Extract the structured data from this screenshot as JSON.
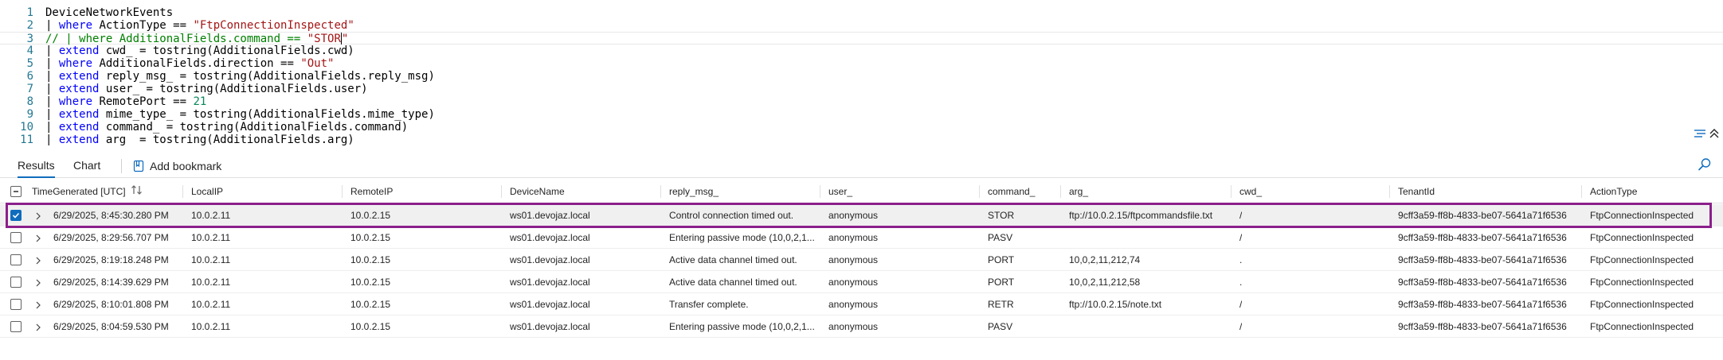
{
  "editor": {
    "lines": [
      {
        "n": "1",
        "parts": [
          {
            "c": "",
            "t": "DeviceNetworkEvents"
          }
        ]
      },
      {
        "n": "2",
        "parts": [
          {
            "c": "",
            "t": "| "
          },
          {
            "c": "kw",
            "t": "where"
          },
          {
            "c": "",
            "t": " ActionType == "
          },
          {
            "c": "str",
            "t": "\"FtpConnectionInspected\""
          }
        ]
      },
      {
        "n": "3",
        "parts": [
          {
            "c": "cmt",
            "t": "// | where AdditionalFields.command == "
          },
          {
            "c": "str",
            "t": "\"STOR"
          },
          {
            "c": "caret",
            "t": ""
          },
          {
            "c": "str",
            "t": "\""
          }
        ]
      },
      {
        "n": "4",
        "parts": [
          {
            "c": "",
            "t": "| "
          },
          {
            "c": "kw",
            "t": "extend"
          },
          {
            "c": "",
            "t": " cwd_ = tostring(AdditionalFields.cwd)"
          }
        ]
      },
      {
        "n": "5",
        "parts": [
          {
            "c": "",
            "t": "| "
          },
          {
            "c": "kw",
            "t": "where"
          },
          {
            "c": "",
            "t": " AdditionalFields.direction == "
          },
          {
            "c": "str",
            "t": "\"Out\""
          }
        ]
      },
      {
        "n": "6",
        "parts": [
          {
            "c": "",
            "t": "| "
          },
          {
            "c": "kw",
            "t": "extend"
          },
          {
            "c": "",
            "t": " reply_msg_ = tostring(AdditionalFields.reply_msg)"
          }
        ]
      },
      {
        "n": "7",
        "parts": [
          {
            "c": "",
            "t": "| "
          },
          {
            "c": "kw",
            "t": "extend"
          },
          {
            "c": "",
            "t": " user_ = tostring(AdditionalFields.user)"
          }
        ]
      },
      {
        "n": "8",
        "parts": [
          {
            "c": "",
            "t": "| "
          },
          {
            "c": "kw",
            "t": "where"
          },
          {
            "c": "",
            "t": " RemotePort == "
          },
          {
            "c": "num",
            "t": "21"
          }
        ]
      },
      {
        "n": "9",
        "parts": [
          {
            "c": "",
            "t": "| "
          },
          {
            "c": "kw",
            "t": "extend"
          },
          {
            "c": "",
            "t": " mime_type_ = tostring(AdditionalFields.mime_type)"
          }
        ]
      },
      {
        "n": "10",
        "parts": [
          {
            "c": "",
            "t": "| "
          },
          {
            "c": "kw",
            "t": "extend"
          },
          {
            "c": "",
            "t": " command_ = tostring(AdditionalFields.command)"
          }
        ]
      },
      {
        "n": "11",
        "parts": [
          {
            "c": "",
            "t": "| "
          },
          {
            "c": "kw",
            "t": "extend"
          },
          {
            "c": "",
            "t": " arg_ = tostring(AdditionalFields.arg)"
          }
        ]
      }
    ],
    "resize_handle": "...",
    "icons": [
      "format-query-icon",
      "collapse-editor-icon"
    ]
  },
  "toolbar": {
    "tab_results": "Results",
    "tab_chart": "Chart",
    "add_bookmark": "Add bookmark",
    "icons": [
      "bookmark-icon",
      "search-icon"
    ]
  },
  "grid": {
    "columns": [
      "TimeGenerated [UTC]",
      "LocalIP",
      "RemoteIP",
      "DeviceName",
      "reply_msg_",
      "user_",
      "command_",
      "arg_",
      "cwd_",
      "TenantId",
      "ActionType"
    ],
    "rows": [
      {
        "selected": true,
        "cells": [
          "6/29/2025, 8:45:30.280 PM",
          "10.0.2.11",
          "10.0.2.15",
          "ws01.devojaz.local",
          "Control connection timed out.",
          "anonymous",
          "STOR",
          "ftp://10.0.2.15/ftpcommandsfile.txt",
          "/",
          "9cff3a59-ff8b-4833-be07-5641a71f6536",
          "FtpConnectionInspected"
        ]
      },
      {
        "selected": false,
        "cells": [
          "6/29/2025, 8:29:56.707 PM",
          "10.0.2.11",
          "10.0.2.15",
          "ws01.devojaz.local",
          "Entering passive mode (10,0,2,1...",
          "anonymous",
          "PASV",
          "",
          "/",
          "9cff3a59-ff8b-4833-be07-5641a71f6536",
          "FtpConnectionInspected"
        ]
      },
      {
        "selected": false,
        "cells": [
          "6/29/2025, 8:19:18.248 PM",
          "10.0.2.11",
          "10.0.2.15",
          "ws01.devojaz.local",
          "Active data channel timed out.",
          "anonymous",
          "PORT",
          "10,0,2,11,212,74",
          ".",
          "9cff3a59-ff8b-4833-be07-5641a71f6536",
          "FtpConnectionInspected"
        ]
      },
      {
        "selected": false,
        "cells": [
          "6/29/2025, 8:14:39.629 PM",
          "10.0.2.11",
          "10.0.2.15",
          "ws01.devojaz.local",
          "Active data channel timed out.",
          "anonymous",
          "PORT",
          "10,0,2,11,212,58",
          ".",
          "9cff3a59-ff8b-4833-be07-5641a71f6536",
          "FtpConnectionInspected"
        ]
      },
      {
        "selected": false,
        "cells": [
          "6/29/2025, 8:10:01.808 PM",
          "10.0.2.11",
          "10.0.2.15",
          "ws01.devojaz.local",
          "Transfer complete.",
          "anonymous",
          "RETR",
          "ftp://10.0.2.15/note.txt",
          "/",
          "9cff3a59-ff8b-4833-be07-5641a71f6536",
          "FtpConnectionInspected"
        ]
      },
      {
        "selected": false,
        "cells": [
          "6/29/2025, 8:04:59.530 PM",
          "10.0.2.11",
          "10.0.2.15",
          "ws01.devojaz.local",
          "Entering passive mode (10,0,2,1...",
          "anonymous",
          "PASV",
          "",
          "/",
          "9cff3a59-ff8b-4833-be07-5641a71f6536",
          "FtpConnectionInspected"
        ]
      }
    ]
  },
  "colors": {
    "accent": "#0f6cbd",
    "selection_outline": "#8b1f8b",
    "keyword": "#0000ff",
    "string": "#a31515",
    "comment": "#008000",
    "number": "#098658",
    "line_number": "#237893"
  }
}
